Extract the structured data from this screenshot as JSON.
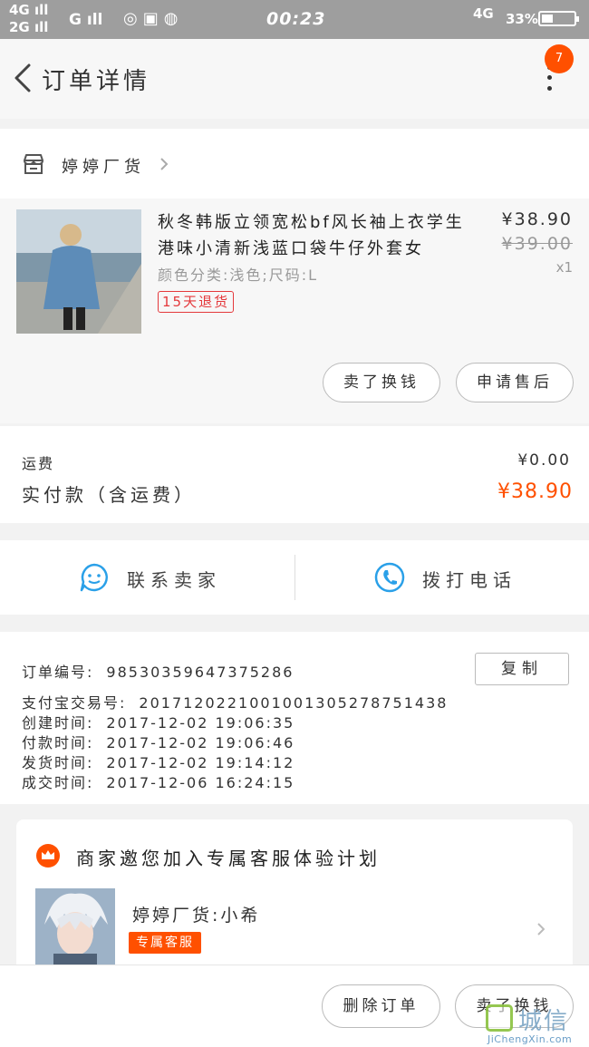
{
  "status_bar": {
    "network_top": "4G",
    "network_bottom": "2G",
    "network_g": "G",
    "time": "00:23",
    "network_right": "4G",
    "battery": "33%"
  },
  "header": {
    "title": "订单详情",
    "badge_count": "7"
  },
  "shop": {
    "name": "婷婷厂货"
  },
  "product": {
    "title": "秋冬韩版立领宽松bf风长袖上衣学生港味小清新浅蓝口袋牛仔外套女",
    "sku": "颜色分类:浅色;尺码:L",
    "tag": "15天退货",
    "price": "¥38.90",
    "original_price": "¥39.00",
    "quantity": "x1",
    "actions": [
      "卖了换钱",
      "申请售后"
    ]
  },
  "fees": {
    "shipping_label": "运费",
    "shipping_value": "¥0.00",
    "paid_label": "实付款（含运费）",
    "paid_value": "¥38.90"
  },
  "contact": {
    "seller_label": "联系卖家",
    "phone_label": "拨打电话"
  },
  "order_info": {
    "copy_label": "复制",
    "rows": [
      {
        "label": "订单编号:",
        "value": "98530359647375286"
      },
      {
        "label": "支付宝交易号:",
        "value": "2017120221001001305278751438"
      },
      {
        "label": "创建时间:",
        "value": "2017-12-02  19:06:35"
      },
      {
        "label": "付款时间:",
        "value": "2017-12-02  19:06:46"
      },
      {
        "label": "发货时间:",
        "value": "2017-12-02  19:14:12"
      },
      {
        "label": "成交时间:",
        "value": "2017-12-06  16:24:15"
      }
    ]
  },
  "invite": {
    "title": "商家邀您加入专属客服体验计划",
    "agent_name": "婷婷厂货:小希",
    "agent_tag": "专属客服"
  },
  "bottom_actions": {
    "delete_label": "删除订单",
    "sell_label": "卖了换钱"
  },
  "watermark": {
    "name": "城信",
    "url": "JiChengXin.com"
  },
  "colors": {
    "accent": "#ff5000",
    "tag_red": "#e4393c",
    "icon_blue": "#2aa0e8",
    "status_bar": "#9e9e9e"
  }
}
